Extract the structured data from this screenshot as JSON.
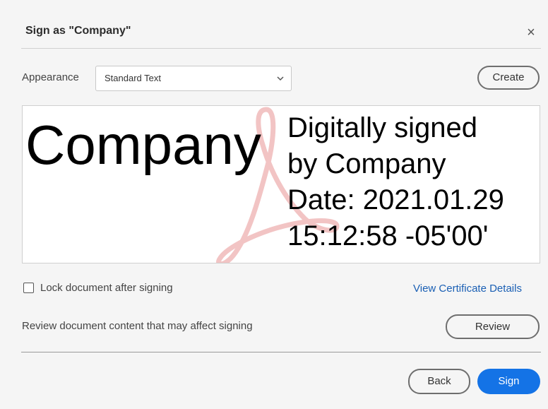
{
  "dialog": {
    "title": "Sign as \"Company\"",
    "close_glyph": "×"
  },
  "appearance": {
    "label": "Appearance",
    "selected": "Standard Text",
    "create_label": "Create"
  },
  "preview": {
    "name": "Company",
    "details_line1": "Digitally signed",
    "details_line2": "by Company",
    "details_line3": "Date: 2021.01.29",
    "details_line4": "15:12:58 -05'00'",
    "watermark_icon": "acrobat-logo-icon",
    "watermark_color": "#f2c4c4"
  },
  "lock": {
    "label": "Lock document after signing",
    "checked": false
  },
  "certificate_link": "View Certificate Details",
  "review": {
    "text": "Review document content that may affect signing",
    "button_label": "Review"
  },
  "footer": {
    "back_label": "Back",
    "sign_label": "Sign",
    "accent_color": "#1473e6"
  }
}
